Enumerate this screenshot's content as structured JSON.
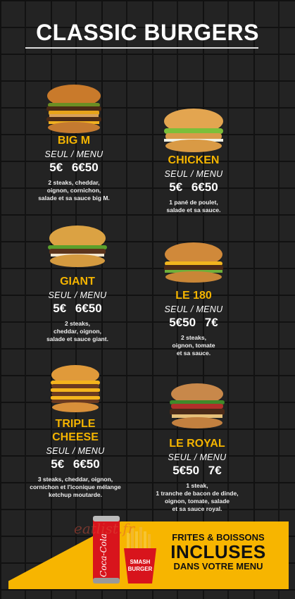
{
  "title": "CLASSIC BURGERS",
  "seul_menu": "SEUL / MENU",
  "items": [
    {
      "name": "BIG M",
      "price": "5€ 6€50",
      "desc": [
        "2 steaks, cheddar,",
        "oignon, cornichon,",
        "salade et sa sauce big M."
      ]
    },
    {
      "name": "CHICKEN",
      "price": "5€ 6€50",
      "desc": [
        "1 pané de poulet,",
        "salade et sa sauce."
      ]
    },
    {
      "name": "GIANT",
      "price": "5€ 6€50",
      "desc": [
        "2 steaks,",
        "cheddar, oignon,",
        "salade et sauce giant."
      ]
    },
    {
      "name": "LE 180",
      "price": "5€50 7€",
      "desc": [
        "2 steaks,",
        "oignon, tomate",
        "et sa sauce."
      ]
    },
    {
      "name": [
        "TRIPLE",
        "CHEESE"
      ],
      "price": "5€ 6€50",
      "desc": [
        "3 steaks, cheddar, oignon,",
        "cornichon et l'iconique mélange",
        "ketchup moutarde."
      ]
    },
    {
      "name": "LE ROYAL",
      "price": "5€50 7€",
      "desc": [
        "1 steak,",
        "1 tranche de bacon de dinde,",
        "oignon, tomate, salade",
        "et sa sauce royal."
      ]
    }
  ],
  "banner": {
    "line1": "FRITES & BOISSONS",
    "line2": "INCLUSES",
    "line3": "DANS VOTRE MENU"
  },
  "can_text": "Coca-Cola",
  "fries_text": [
    "SMASH",
    "BURGER"
  ],
  "watermark": "eatlist.fr"
}
